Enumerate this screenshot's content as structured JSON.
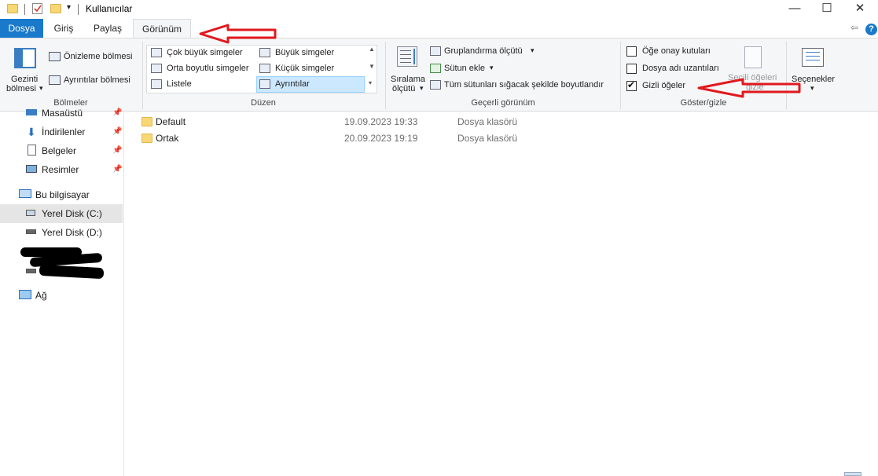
{
  "window": {
    "title": "Kullanıcılar",
    "minimize": "—",
    "maximize": "☐",
    "close": "✕"
  },
  "tabs": [
    {
      "label": "Dosya"
    },
    {
      "label": "Giriş"
    },
    {
      "label": "Paylaş"
    },
    {
      "label": "Görünüm"
    }
  ],
  "tab_right": {
    "collapse": "⇦",
    "help": "?"
  },
  "ribbon": {
    "panes": {
      "navigation_pane": "Gezinti\nbölmesi",
      "navigation_pane_line1": "Gezinti",
      "navigation_pane_line2": "bölmesi",
      "preview_pane": "Önizleme bölmesi",
      "details_pane": "Ayrıntılar bölmesi",
      "group_label": "Bölmeler"
    },
    "layout": {
      "items": [
        "Çok büyük simgeler",
        "Büyük simgeler",
        "Orta boyutlu simgeler",
        "Küçük simgeler",
        "Listele",
        "Ayrıntılar"
      ],
      "group_label": "Düzen"
    },
    "current_view": {
      "sort_line1": "Sıralama",
      "sort_line2": "ölçütü",
      "group_by": "Gruplandırma ölçütü",
      "add_columns": "Sütun ekle",
      "size_columns": "Tüm sütunları sığacak şekilde boyutlandır",
      "group_label": "Geçerli görünüm"
    },
    "show_hide": {
      "item_checkboxes": "Öğe onay kutuları",
      "item_checkboxes_checked": false,
      "file_extensions": "Dosya adı uzantıları",
      "file_extensions_checked": false,
      "hidden_items": "Gizli öğeler",
      "hidden_items_checked": true,
      "hide_selected_line1": "Seçili öğeleri",
      "hide_selected_line2": "gizle",
      "group_label": "Göster/gizle"
    },
    "options": {
      "label": "Seçenekler"
    }
  },
  "nav": {
    "items": [
      {
        "label": "Masaüstü",
        "pinned": true
      },
      {
        "label": "İndirilenler",
        "pinned": true
      },
      {
        "label": "Belgeler",
        "pinned": true
      },
      {
        "label": "Resimler",
        "pinned": true
      },
      {
        "label": "Bu bilgisayar"
      },
      {
        "label": "Yerel Disk (C:)",
        "selected": true
      },
      {
        "label": "Yerel Disk (D:)"
      },
      {
        "label": "Ağ"
      }
    ]
  },
  "files": [
    {
      "name": "Default",
      "date": "19.09.2023 19:33",
      "type": "Dosya klasörü"
    },
    {
      "name": "Ortak",
      "date": "20.09.2023 19:19",
      "type": "Dosya klasörü"
    }
  ],
  "colors": {
    "accent": "#1979ca",
    "annotation_arrow": "#e0191e",
    "folder": "#f8d775",
    "ribbon_bg": "#f5f6f7",
    "selection": "#cce8ff"
  }
}
